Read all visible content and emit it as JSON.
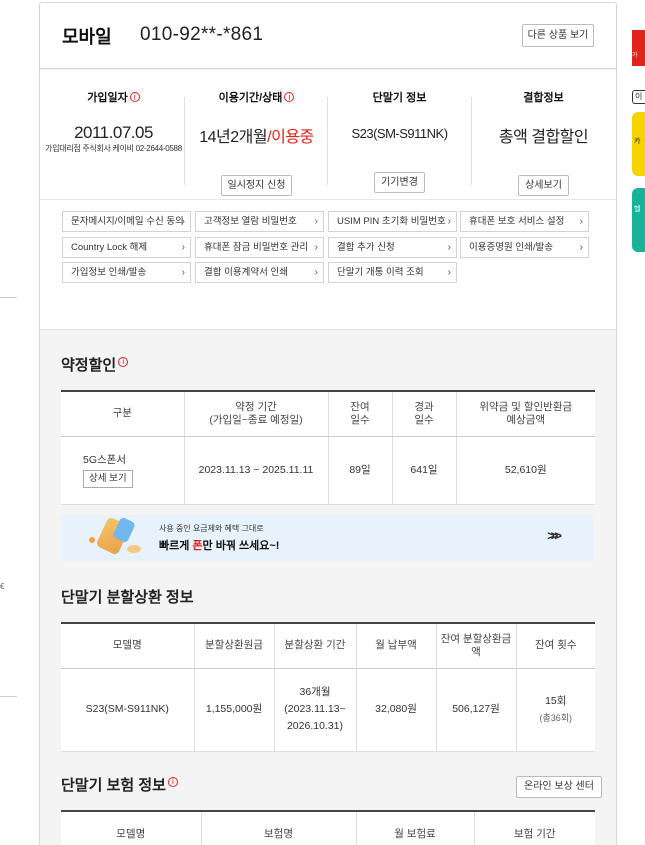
{
  "header": {
    "title": "모바일",
    "phone_number": "010-92**-*861",
    "other_products_button": "다른 상품 보기"
  },
  "summary": {
    "join_date": {
      "label": "가입일자",
      "value": "2011.07.05",
      "agency": "가입대리점 주식회사 케이비 02-2644-0588"
    },
    "usage": {
      "label": "이용기간/상태",
      "period": "14년2개월",
      "slash": "/",
      "status": "이용중",
      "button": "일시정지 신청"
    },
    "device": {
      "label": "단말기 정보",
      "value": "S23(SM-S911NK)",
      "button": "기기변경"
    },
    "combo": {
      "label": "결합정보",
      "value": "총액 결합할인",
      "button": "상세보기"
    },
    "info_mark": "i"
  },
  "links": [
    "문자메시지/이메일 수신 동의",
    "고객정보 열람 비밀번호",
    "USIM PIN 초기화 비밀번호",
    "휴대폰 보호 서비스 설정",
    "Country Lock 해제",
    "휴대폰 잠금 비밀번호 관리",
    "결합 추가 신청",
    "이용증명원 인쇄/발송",
    "가입정보 인쇄/발송",
    "결합 이용계약서 인쇄",
    "단말기 개통 이력 조회"
  ],
  "link_arrow": "›",
  "contract": {
    "title": "약정할인",
    "headers": [
      "구분",
      "약정 기간\n(가입일~종료 예정일)",
      "잔여\n일수",
      "경과\n일수",
      "위약금 및 할인반환금\n예상금액"
    ],
    "row": {
      "plan": "5G스폰서",
      "detail_button": "상세 보기",
      "period": "2023.11.13 ~ 2025.11.11",
      "remaining": "89일",
      "elapsed": "641일",
      "amount": "52,610원"
    }
  },
  "banner": {
    "line1": "사용 중인 요금제와 혜택 그대로",
    "line2_a": "빠르게 ",
    "line2_red": "폰",
    "line2_b": "만 바꿔 쓰세요~!",
    "chevron": ">>>"
  },
  "installment": {
    "title": "단말기 분할상환 정보",
    "headers": [
      "모델명",
      "분할상환원금",
      "분할상환 기간",
      "월 납부액",
      "잔여 분할상환금\n액",
      "잔여 횟수"
    ],
    "row": {
      "model": "S23(SM-S911NK)",
      "principal": "1,155,000원",
      "months": "36개월",
      "range": "(2023.11.13~\n2026.10.31)",
      "monthly": "32,080원",
      "remaining_amount": "506,127원",
      "remaining_count": "15회",
      "total_count": "(총36회)"
    }
  },
  "insurance": {
    "title": "단말기 보험 정보",
    "online_button": "온라인 보상 센터",
    "headers": [
      "모델명",
      "보험명",
      "월 보험료",
      "보험 기간"
    ]
  },
  "right_fragments": {
    "r1": "가",
    "r2": "이",
    "r3": "카",
    "r4": "헬"
  },
  "left_fragment": "€"
}
